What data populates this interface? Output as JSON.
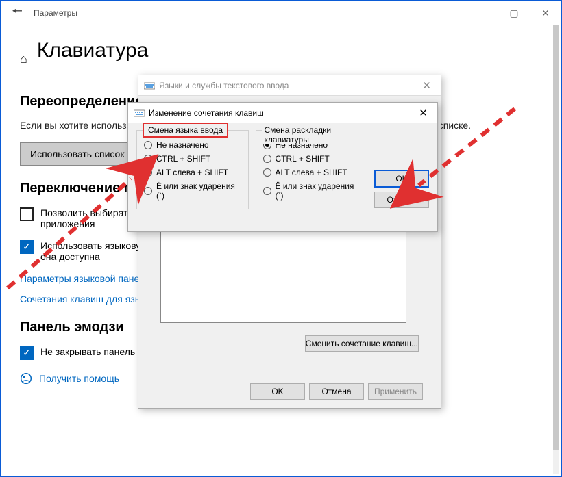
{
  "window": {
    "title": "Параметры",
    "home_icon": "⌂",
    "page_title": "Клавиатура",
    "section1_heading": "Переопределение",
    "section1_text": "Если вы хотите использовать языковую панель, поставьте флажок на первом месте в вашем списке.",
    "section1_button": "Использовать список языков",
    "section2_heading": "Переключение методов ввода",
    "check1_label": "Позволить выбирать метод ввода для каждого приложения",
    "check2_label": "Использовать языковую панель на рабочем столе, если она доступна",
    "link1": "Параметры языковой панели",
    "link2": "Сочетания клавиш для языков",
    "section3_heading": "Панель эмодзи",
    "check3_label": "Не закрывать панель автоматически после ввода эмодзи",
    "help_link": "Получить помощь"
  },
  "dialog1": {
    "title": "Языки и службы текстового ввода",
    "change_combo_btn": "Сменить сочетание клавиш...",
    "ok": "OK",
    "cancel": "Отмена",
    "apply": "Применить"
  },
  "dialog2": {
    "title": "Изменение сочетания клавиш",
    "group1_title": "Смена языка ввода",
    "group2_title": "Смена раскладки клавиатуры",
    "options": {
      "none": "Не назначено",
      "ctrl_shift": "CTRL + SHIFT",
      "alt_shift": "ALT слева + SHIFT",
      "grave": "Ё или знак ударения (`)"
    },
    "ok": "OK",
    "cancel": "Отмена"
  }
}
